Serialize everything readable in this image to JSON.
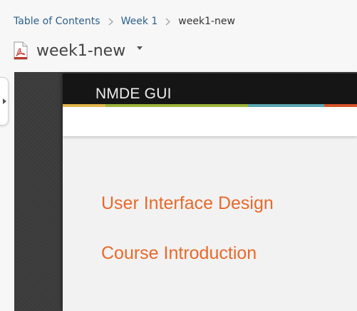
{
  "breadcrumb": {
    "items": [
      "Table of Contents",
      "Week 1"
    ],
    "current": "week1-new"
  },
  "document": {
    "title": "week1-new",
    "icon": "pdf-file-icon"
  },
  "slide": {
    "header_title": "NMDE GUI",
    "lines": [
      "User Interface Design",
      "Course Introduction"
    ],
    "colors": {
      "header_bg": "#151515",
      "text_accent": "#e8692a",
      "strip": [
        "#e3b54a",
        "#9bb43a",
        "#5aa7b4",
        "#d9542c"
      ]
    }
  }
}
